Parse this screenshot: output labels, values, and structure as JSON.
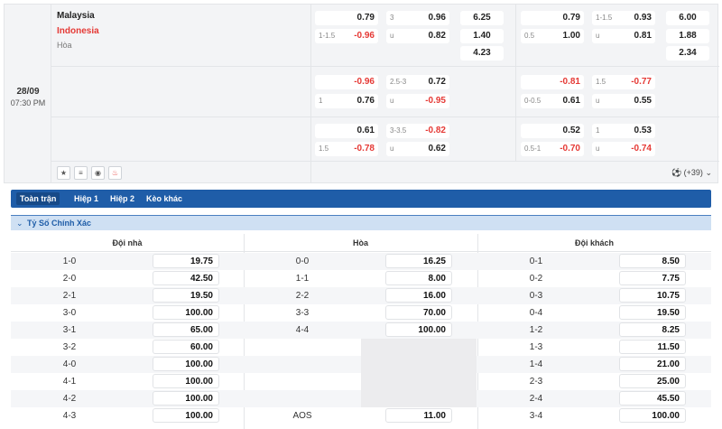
{
  "match": {
    "date": "28/09",
    "time": "07:30 PM",
    "home": "Malaysia",
    "away": "Indonesia",
    "draw": "Hòa",
    "rows": [
      {
        "full": {
          "h1": "",
          "v1": "0.79",
          "h2": "1-1.5",
          "v2": "-0.96",
          "ou1h": "3",
          "ou1": "0.96",
          "ou2h": "u",
          "ou2": "0.82",
          "x1": "6.25",
          "x2": "1.40",
          "x3": "4.23"
        },
        "half": {
          "h1": "",
          "v1": "0.79",
          "h2": "0.5",
          "v2": "1.00",
          "ou1h": "1-1.5",
          "ou1": "0.93",
          "ou2h": "u",
          "ou2": "0.81",
          "x1": "6.00",
          "x2": "1.88",
          "x3": "2.34"
        }
      },
      {
        "full": {
          "h1": "",
          "v1": "-0.96",
          "h2": "1",
          "v2": "0.76",
          "ou1h": "2.5-3",
          "ou1": "0.72",
          "ou2h": "u",
          "ou2": "-0.95"
        },
        "half": {
          "h1": "",
          "v1": "-0.81",
          "h2": "0-0.5",
          "v2": "0.61",
          "ou1h": "1.5",
          "ou1": "-0.77",
          "ou2h": "u",
          "ou2": "0.55"
        }
      },
      {
        "full": {
          "h1": "",
          "v1": "0.61",
          "h2": "1.5",
          "v2": "-0.78",
          "ou1h": "3-3.5",
          "ou1": "-0.82",
          "ou2h": "u",
          "ou2": "0.62"
        },
        "half": {
          "h1": "",
          "v1": "0.52",
          "h2": "0.5-1",
          "v2": "-0.70",
          "ou1h": "1",
          "ou1": "0.53",
          "ou2h": "u",
          "ou2": "-0.74"
        }
      }
    ],
    "more_count": "(+39)"
  },
  "icons": [
    "star-icon",
    "database-icon",
    "eye-icon",
    "fire-icon"
  ],
  "tabs": [
    "Toàn trận",
    "Hiệp 1",
    "Hiệp 2",
    "Kèo khác"
  ],
  "section": {
    "title": "Tỷ Số Chính Xác",
    "columns": [
      "Đội nhà",
      "Hòa",
      "Đội khách"
    ],
    "home": [
      {
        "score": "1-0",
        "odds": "19.75"
      },
      {
        "score": "2-0",
        "odds": "42.50"
      },
      {
        "score": "2-1",
        "odds": "19.50"
      },
      {
        "score": "3-0",
        "odds": "100.00"
      },
      {
        "score": "3-1",
        "odds": "65.00"
      },
      {
        "score": "3-2",
        "odds": "60.00"
      },
      {
        "score": "4-0",
        "odds": "100.00"
      },
      {
        "score": "4-1",
        "odds": "100.00"
      },
      {
        "score": "4-2",
        "odds": "100.00"
      },
      {
        "score": "4-3",
        "odds": "100.00"
      }
    ],
    "draw": [
      {
        "score": "0-0",
        "odds": "16.25"
      },
      {
        "score": "1-1",
        "odds": "8.00"
      },
      {
        "score": "2-2",
        "odds": "16.00"
      },
      {
        "score": "3-3",
        "odds": "70.00"
      },
      {
        "score": "4-4",
        "odds": "100.00"
      },
      null,
      null,
      null,
      null,
      {
        "score": "AOS",
        "odds": "11.00"
      }
    ],
    "away": [
      {
        "score": "0-1",
        "odds": "8.50"
      },
      {
        "score": "0-2",
        "odds": "7.75"
      },
      {
        "score": "0-3",
        "odds": "10.75"
      },
      {
        "score": "0-4",
        "odds": "19.50"
      },
      {
        "score": "1-2",
        "odds": "8.25"
      },
      {
        "score": "1-3",
        "odds": "11.50"
      },
      {
        "score": "1-4",
        "odds": "21.00"
      },
      {
        "score": "2-3",
        "odds": "25.00"
      },
      {
        "score": "2-4",
        "odds": "45.50"
      },
      {
        "score": "3-4",
        "odds": "100.00"
      }
    ]
  }
}
